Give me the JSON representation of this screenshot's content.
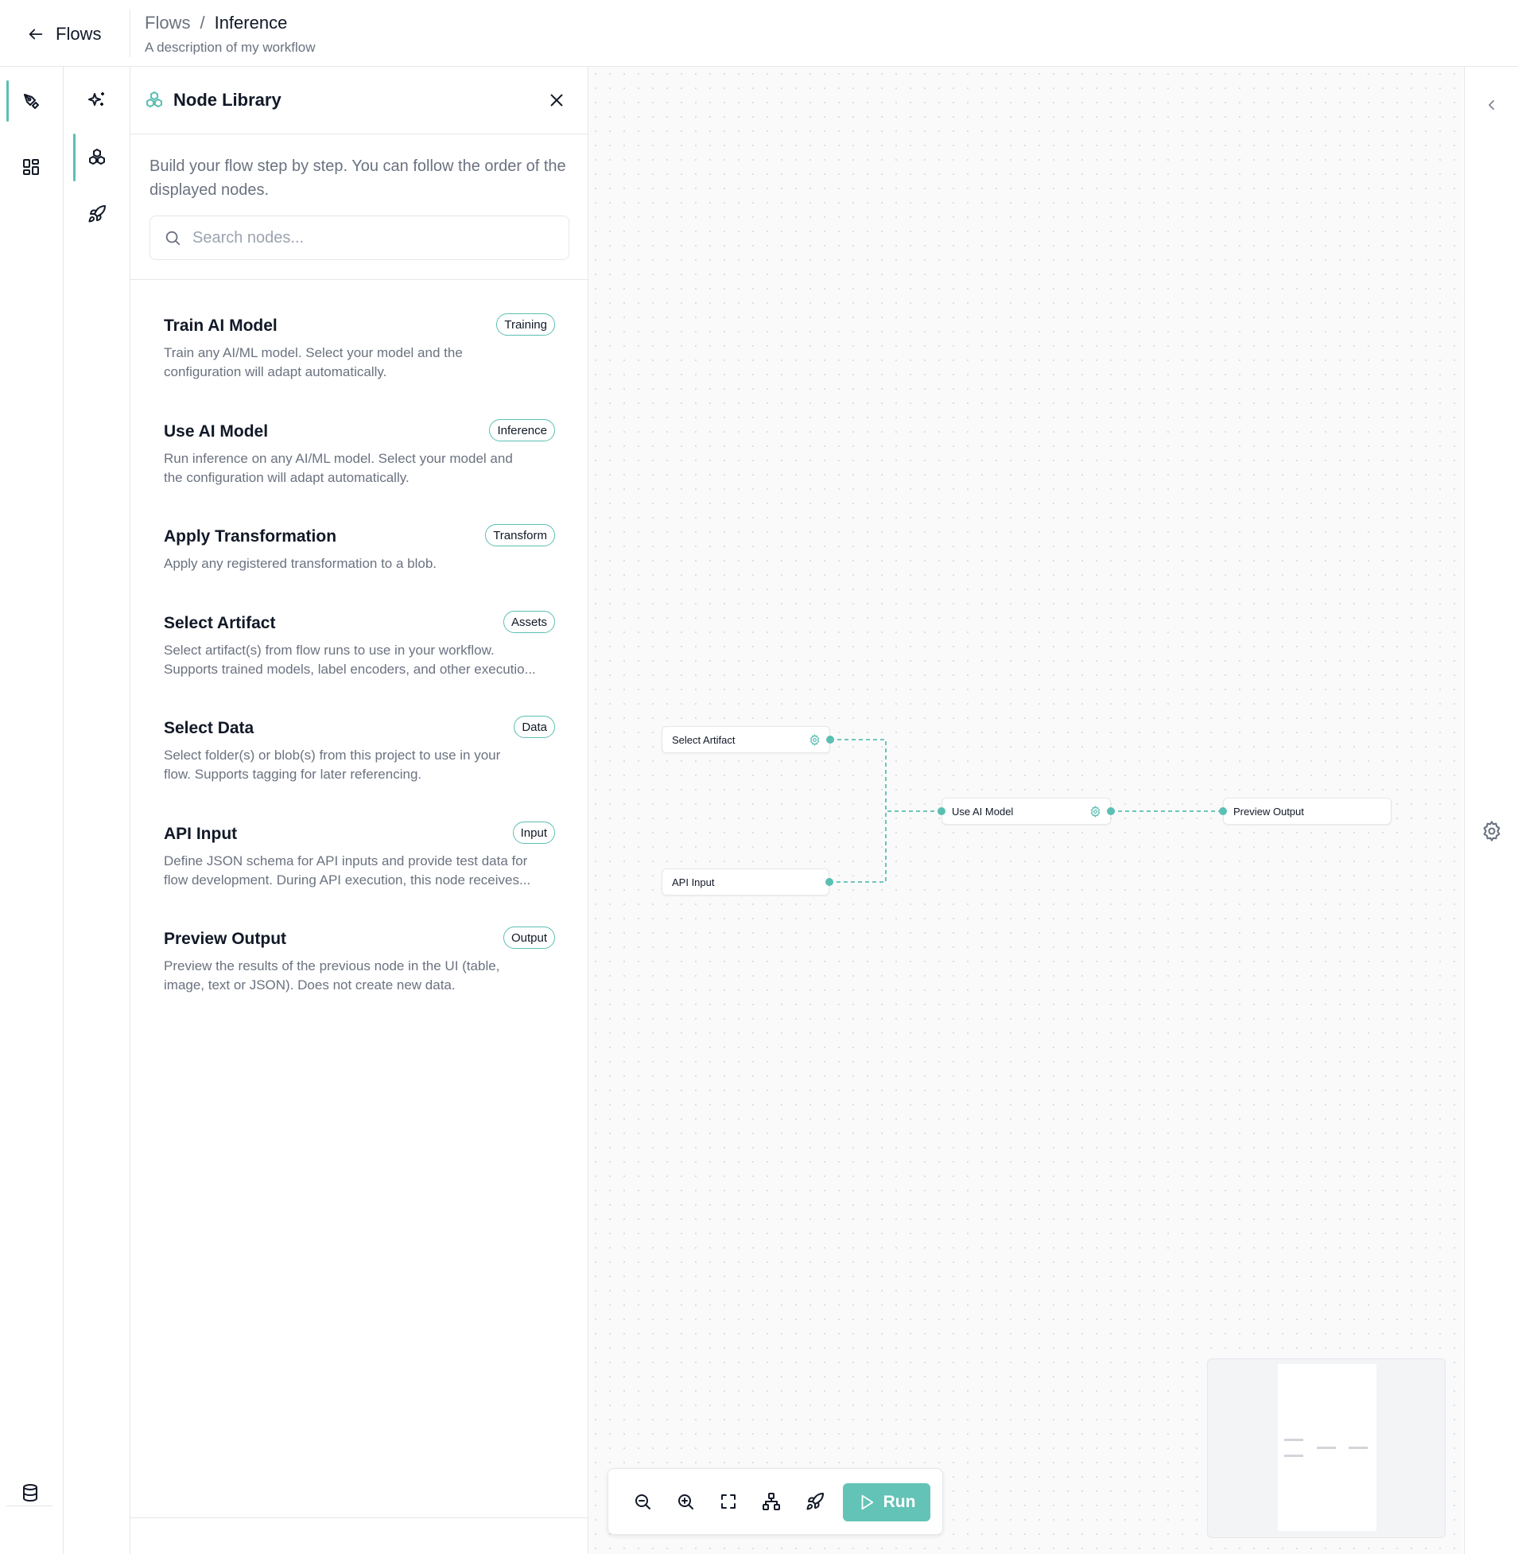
{
  "header": {
    "back_label": "Flows",
    "breadcrumb": {
      "parent": "Flows",
      "separator": "/",
      "current": "Inference"
    },
    "description": "A description of my workflow"
  },
  "sidebar": {
    "primary": [
      {
        "icon": "pen-tool-icon",
        "active": true
      },
      {
        "icon": "dashboard-icon",
        "active": false
      }
    ],
    "bottom": {
      "icon": "database-icon"
    },
    "secondary": [
      {
        "icon": "sparkles-icon",
        "active": false
      },
      {
        "icon": "node-library-icon",
        "active": true
      },
      {
        "icon": "rocket-icon",
        "active": false
      }
    ]
  },
  "node_library": {
    "title": "Node Library",
    "intro": "Build your flow step by step. You can follow the order of the displayed nodes.",
    "search_placeholder": "Search nodes...",
    "nodes": [
      {
        "title": "Train AI Model",
        "badge": "Training",
        "desc1": "Train any AI/ML model. Select your model and the",
        "desc2": "configuration will adapt automatically."
      },
      {
        "title": "Use AI Model",
        "badge": "Inference",
        "desc1": "Run inference on any AI/ML model. Select your model and",
        "desc2": "the configuration will adapt automatically."
      },
      {
        "title": "Apply Transformation",
        "badge": "Transform",
        "desc1": "Apply any registered transformation to a blob.",
        "desc2": ""
      },
      {
        "title": "Select Artifact",
        "badge": "Assets",
        "desc1": "Select artifact(s) from flow runs to use in your workflow.",
        "desc2": "Supports trained models, label encoders, and other executio..."
      },
      {
        "title": "Select Data",
        "badge": "Data",
        "desc1": "Select folder(s) or blob(s) from this project to use in your",
        "desc2": "flow. Supports tagging for later referencing."
      },
      {
        "title": "API Input",
        "badge": "Input",
        "desc1": "Define JSON schema for API inputs and provide test data for",
        "desc2": "flow development. During API execution, this node receives..."
      },
      {
        "title": "Preview Output",
        "badge": "Output",
        "desc1": "Preview the results of the previous node in the UI (table,",
        "desc2": "image, text or JSON). Does not create new data."
      }
    ]
  },
  "canvas": {
    "nodes": {
      "select_artifact": "Select Artifact",
      "api_input": "API Input",
      "use_ai_model": "Use AI Model",
      "preview_output": "Preview Output"
    },
    "toolbar": {
      "icons": [
        "zoom-out-icon",
        "zoom-in-icon",
        "fit-view-icon",
        "auto-layout-icon",
        "rocket-icon"
      ],
      "run_label": "Run"
    }
  },
  "colors": {
    "accent": "#5bbfb3",
    "run_button": "#63c3b6",
    "border": "#e5e7eb",
    "muted_text": "#6b7280",
    "canvas_bg": "#fafafa"
  }
}
